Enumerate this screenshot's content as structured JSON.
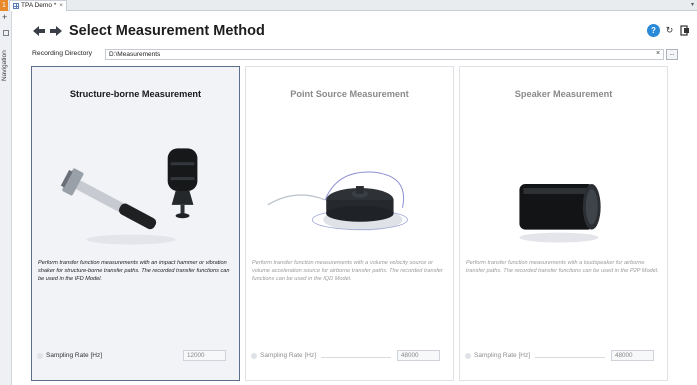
{
  "tabbar": {
    "number": "1",
    "tab_label": "TPA Demo *",
    "close": "×",
    "dropdown": "▾"
  },
  "leftnav": {
    "plus": "+",
    "label": "Navigation"
  },
  "header": {
    "title": "Select Measurement Method",
    "help": "?",
    "refresh": "↻"
  },
  "recording": {
    "label": "Recording Directory",
    "value": "D:\\Measurements",
    "clear": "×",
    "browse": "..."
  },
  "cards": [
    {
      "title": "Structure-borne Measurement",
      "description": "Perform transfer function measurements with an impact hammer or vibration shaker for structure-borne transfer paths. The recorded transfer functions can be used in the IFD Model.",
      "sampling_label": "Sampling Rate [Hz]",
      "sampling_value": "12000",
      "selected": true
    },
    {
      "title": "Point Source Measurement",
      "description": "Perform transfer function measurements with a volume velocity source or volume acceleration source for airborne transfer paths. The recorded transfer functions can be used in the IQD Model.",
      "sampling_label": "Sampling Rate [Hz]",
      "sampling_value": "48000",
      "selected": false
    },
    {
      "title": "Speaker Measurement",
      "description": "Perform transfer function measurements with a loudspeaker for airborne transfer paths. The recorded transfer functions can be used in the P2P Model.",
      "sampling_label": "Sampling Rate [Hz]",
      "sampling_value": "48000",
      "selected": false
    }
  ],
  "colors": {
    "accent_orange": "#e8892b",
    "help_blue": "#2a8ad8",
    "selected_border": "#5d6d8c"
  }
}
